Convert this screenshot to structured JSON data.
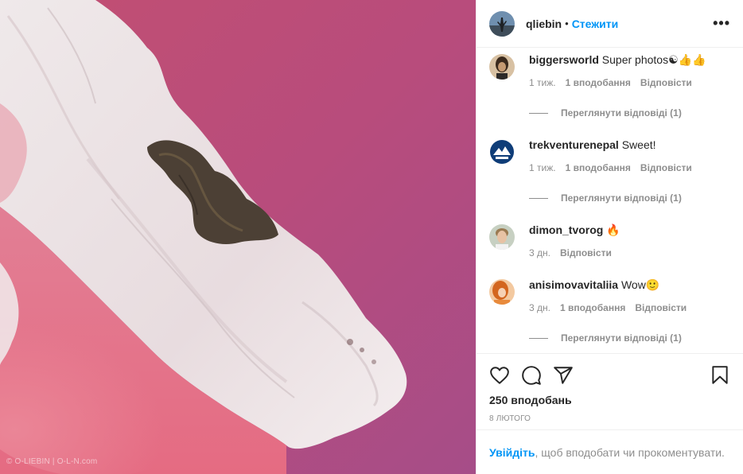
{
  "photo": {
    "watermark": "© O-LIEBIN | O-L-N.com"
  },
  "header": {
    "username": "qliebin",
    "separator": "•",
    "follow_label": "Стежити",
    "more_icon": "more-horizontal-icon"
  },
  "comments": [
    {
      "username": "biggersworld",
      "text": "Super photos☯︎👍👍",
      "time": "1 тиж.",
      "likes": "1 вподобання",
      "reply_label": "Відповісти",
      "view_replies": "Переглянути відповіді (1)"
    },
    {
      "username": "trekventurenepal",
      "text": "Sweet!",
      "time": "1 тиж.",
      "likes": "1 вподобання",
      "reply_label": "Відповісти",
      "view_replies": "Переглянути відповіді (1)"
    },
    {
      "username": "dimon_tvorog",
      "text": "🔥",
      "time": "3 дн.",
      "reply_label": "Відповісти"
    },
    {
      "username": "anisimovavitaliia",
      "text": "Wow🙂",
      "time": "3 дн.",
      "likes": "1 вподобання",
      "reply_label": "Відповісти",
      "view_replies": "Переглянути відповіді (1)"
    }
  ],
  "actions": {
    "like_icon": "heart-icon",
    "comment_icon": "comment-icon",
    "share_icon": "share-icon",
    "save_icon": "bookmark-icon",
    "likes_count": "250 вподобань",
    "date": "8 лютого"
  },
  "login_prompt": {
    "link": "Увійдіть",
    "text": ", щоб вподобати чи прокоментувати."
  },
  "colors": {
    "accent": "#0095f6",
    "lake_pink": "#c9517a",
    "salt": "#f1ebec"
  }
}
